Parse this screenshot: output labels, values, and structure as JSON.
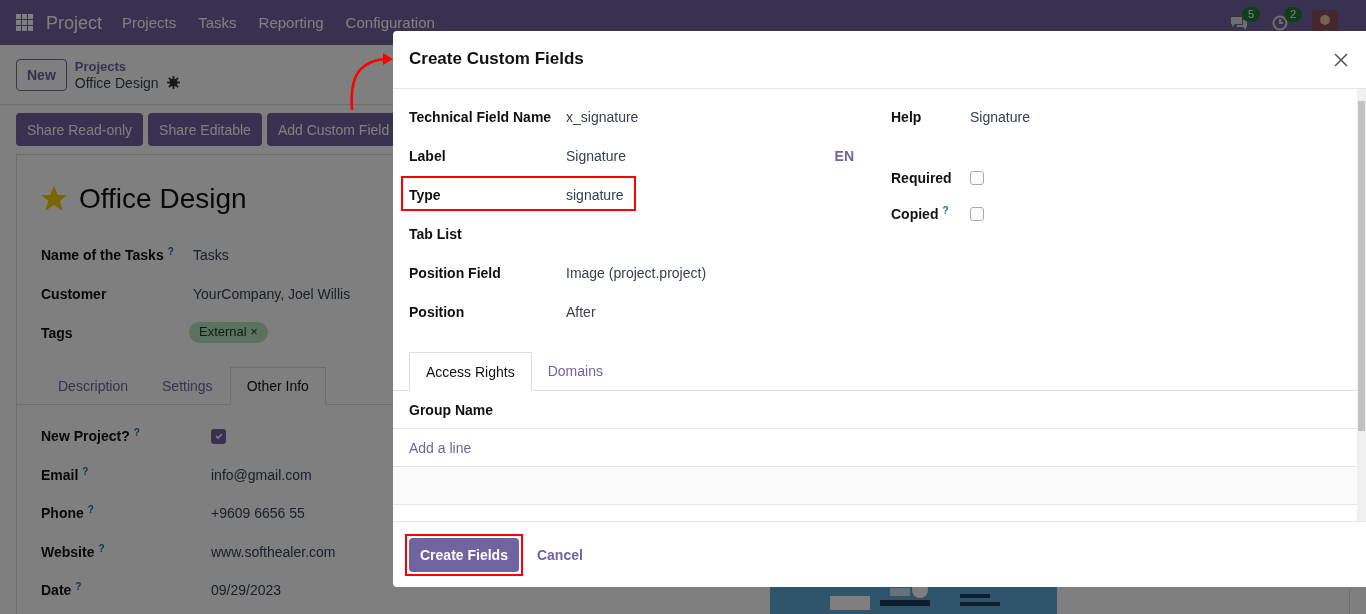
{
  "navbar": {
    "app": "Project",
    "menu": [
      "Projects",
      "Tasks",
      "Reporting",
      "Configuration"
    ],
    "messages_count": "5",
    "activities_count": "2"
  },
  "control_panel": {
    "new_button": "New",
    "breadcrumb": [
      "Projects",
      "Office Design"
    ]
  },
  "action_buttons": [
    "Share Read-only",
    "Share Editable",
    "Add Custom Field"
  ],
  "record": {
    "title": "Office Design",
    "starred": true,
    "fields": [
      {
        "label": "Name of the Tasks",
        "help": "?",
        "kind": "text",
        "value": "Tasks"
      },
      {
        "label": "Customer",
        "kind": "text",
        "value": "YourCompany, Joel Willis"
      },
      {
        "label": "Tags",
        "kind": "tags",
        "tags": [
          "External"
        ],
        "remove": "×"
      }
    ],
    "tabs": [
      {
        "label": "Description",
        "selected": false
      },
      {
        "label": "Settings",
        "selected": false
      },
      {
        "label": "Other Info",
        "selected": true
      }
    ],
    "other_info": [
      {
        "label": "New Project?",
        "help": "?",
        "kind": "checkbox",
        "checked": true
      },
      {
        "label": "Email",
        "help": "?",
        "kind": "text",
        "value": "info@gmail.com"
      },
      {
        "label": "Phone",
        "help": "?",
        "kind": "text",
        "value": "+9609 6656 55"
      },
      {
        "label": "Website",
        "help": "?",
        "kind": "text",
        "value": "www.softhealer.com"
      },
      {
        "label": "Date",
        "help": "?",
        "kind": "text",
        "value": "09/29/2023"
      }
    ]
  },
  "dialog": {
    "title": "Create Custom Fields",
    "left_fields": [
      {
        "label": "Technical Field Name",
        "value": "x_signature",
        "highlighted": false
      },
      {
        "label": "Label",
        "value": "Signature",
        "lang": "EN",
        "highlighted": false
      },
      {
        "label": "Type",
        "value": "signature",
        "highlighted": true
      },
      {
        "label": "Tab List",
        "highlighted": false
      },
      {
        "label": "Position Field",
        "value": "Image (project.project)",
        "highlighted": false
      },
      {
        "label": "Position",
        "value": "After",
        "highlighted": false
      }
    ],
    "right_fields": [
      {
        "label": "Help",
        "kind": "text",
        "value": "Signature"
      },
      {
        "label": "Required",
        "kind": "checkbox",
        "checked": false
      },
      {
        "label": "Copied",
        "help": "?",
        "kind": "checkbox",
        "checked": false
      }
    ],
    "tabs": [
      {
        "label": "Access Rights",
        "selected": true
      },
      {
        "label": "Domains",
        "selected": false
      }
    ],
    "table": {
      "columns": [
        "Group Name"
      ],
      "add_line": "Add a line"
    },
    "buttons": [
      {
        "label": "Create Fields",
        "kind": "primary",
        "highlighted": true
      },
      {
        "label": "Cancel",
        "kind": "link",
        "highlighted": false
      }
    ]
  }
}
